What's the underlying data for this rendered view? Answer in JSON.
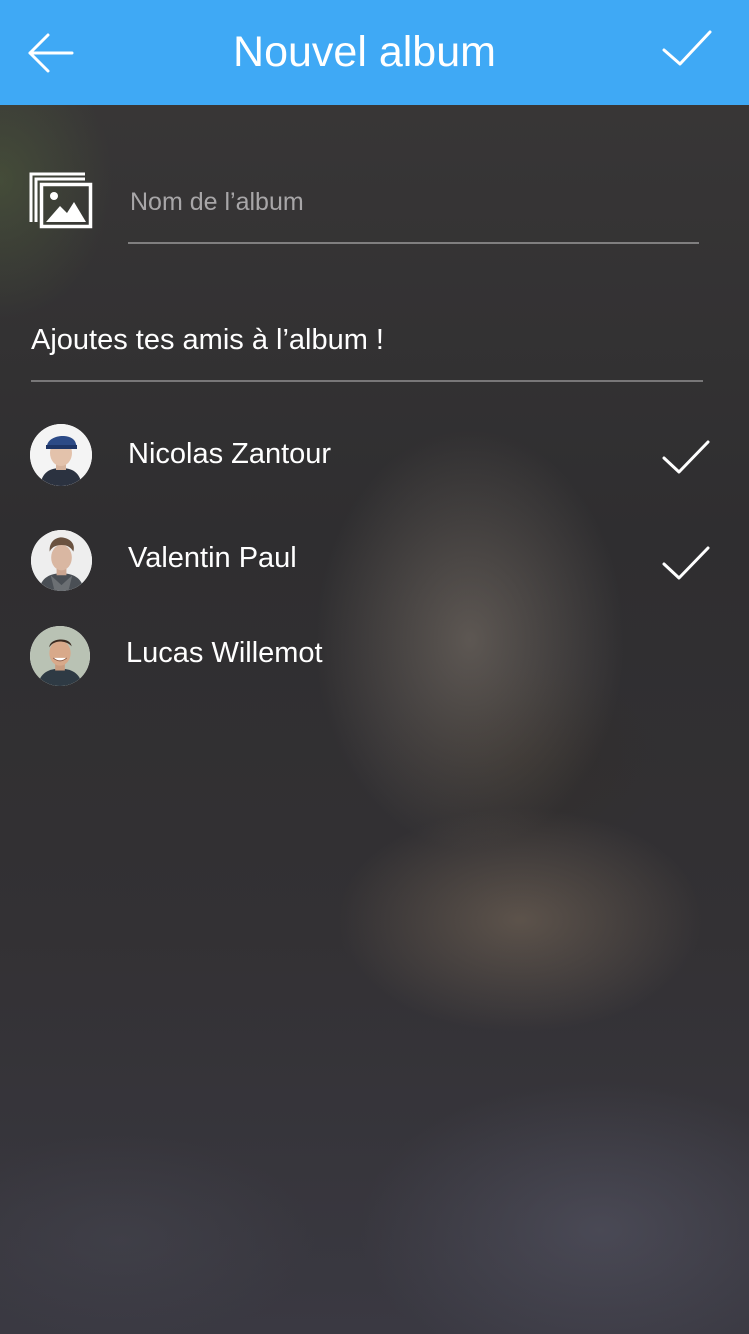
{
  "header": {
    "title": "Nouvel album",
    "back_icon": "arrow-left-icon",
    "confirm_icon": "checkmark-icon",
    "color": "#3fa9f5"
  },
  "album": {
    "icon": "image-gallery-icon",
    "name_value": "",
    "name_placeholder": "Nom de l’album"
  },
  "friends_section": {
    "title": "Ajoutes tes amis à l’album !",
    "friends": [
      {
        "name": "Nicolas Zantour",
        "selected": true,
        "avatar": "avatar-photo"
      },
      {
        "name": "Valentin Paul",
        "selected": true,
        "avatar": "avatar-photo"
      },
      {
        "name": "Lucas Willemot",
        "selected": false,
        "avatar": "avatar-photo"
      }
    ]
  }
}
